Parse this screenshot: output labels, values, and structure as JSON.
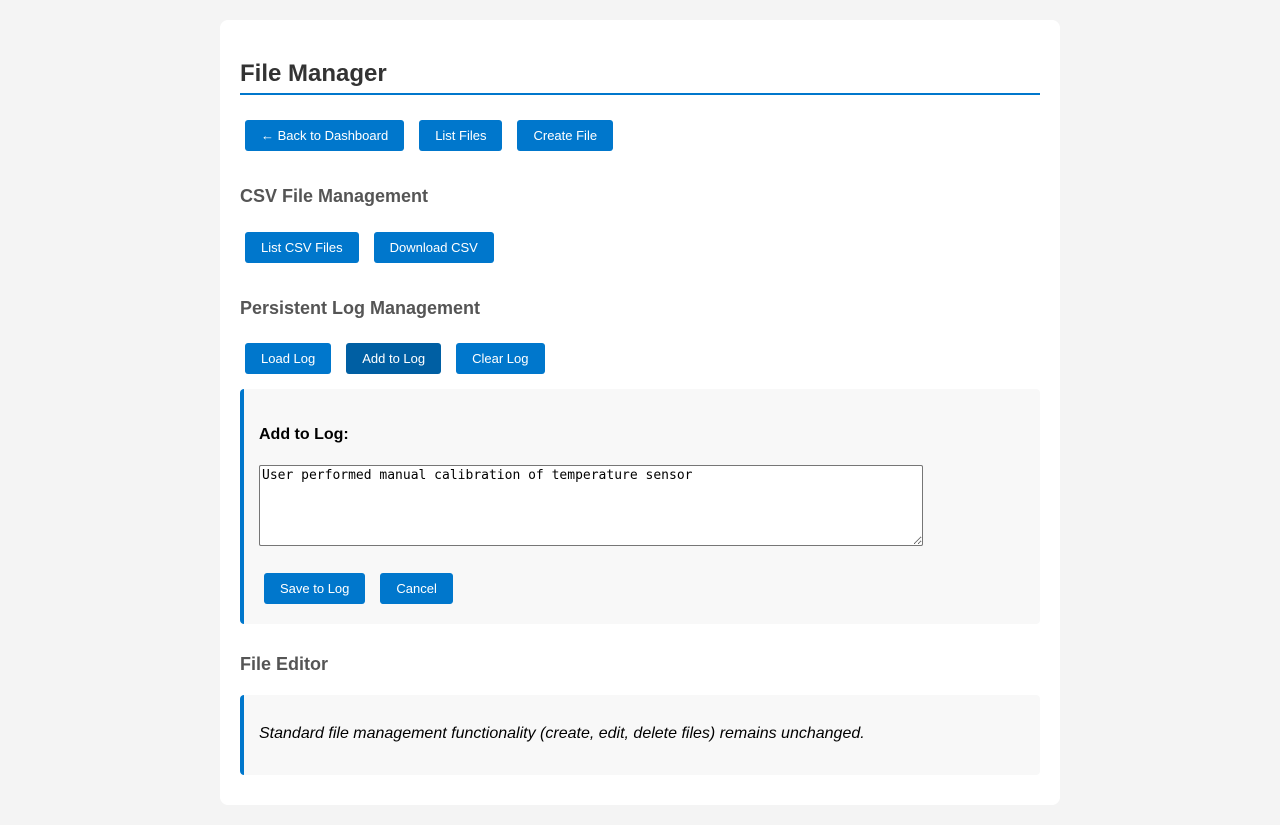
{
  "page": {
    "title": "File Manager"
  },
  "nav_buttons": {
    "back": "← Back to Dashboard",
    "list_files": "List Files",
    "create_file": "Create File"
  },
  "csv": {
    "title": "CSV File Management",
    "list_csv": "List CSV Files",
    "download_csv": "Download CSV"
  },
  "log": {
    "title": "Persistent Log Management",
    "load_log": "Load Log",
    "add_to_log": "Add to Log",
    "clear_log": "Clear Log",
    "active_button": "Add to Log",
    "panel": {
      "label": "Add to Log:",
      "textarea_value": "User performed manual calibration of temperature sensor",
      "save": "Save to Log",
      "cancel": "Cancel"
    }
  },
  "editor": {
    "title": "File Editor",
    "note": "Standard file management functionality (create, edit, delete files) remains unchanged."
  },
  "colors": {
    "accent": "#0077cc",
    "accent_active": "#005fa3",
    "background": "#f4f4f4",
    "panel": "#f8f8f8"
  }
}
